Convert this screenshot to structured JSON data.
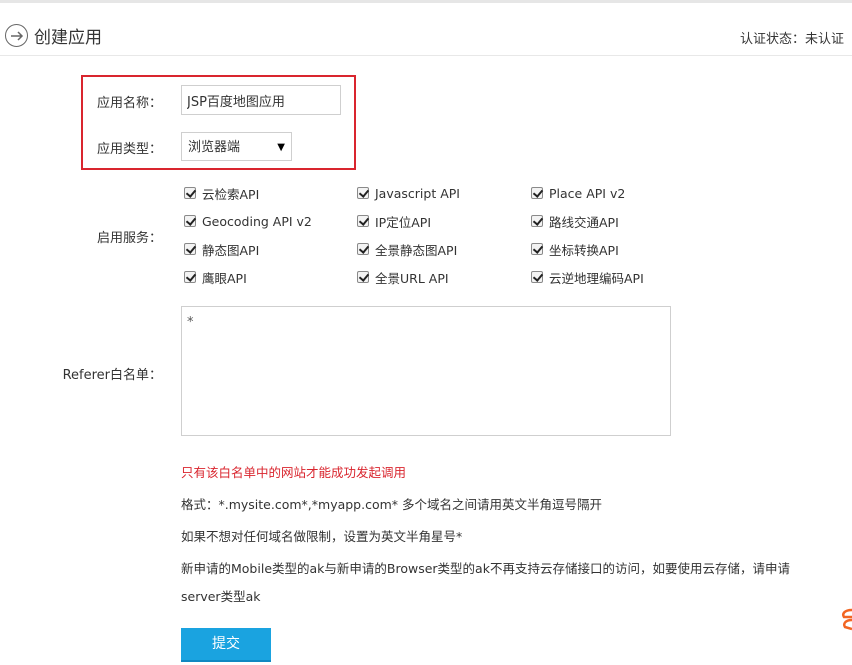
{
  "header": {
    "title": "创建应用",
    "auth_status": "认证状态：未认证"
  },
  "form": {
    "app_name_label": "应用名称：",
    "app_name_value": "JSP百度地图应用",
    "app_type_label": "应用类型：",
    "app_type_value": "浏览器端",
    "services_label": "启用服务：",
    "services": [
      [
        "云检索API",
        "Javascript API",
        "Place API v2"
      ],
      [
        "Geocoding API v2",
        "IP定位API",
        "路线交通API"
      ],
      [
        "静态图API",
        "全景静态图API",
        "坐标转换API"
      ],
      [
        "鹰眼API",
        "全景URL API",
        "云逆地理编码API"
      ]
    ],
    "referer_label": "Referer白名单：",
    "referer_value": "*"
  },
  "notes": {
    "warning": "只有该白名单中的网站才能成功发起调用",
    "format": "格式：*.mysite.com*,*myapp.com* 多个域名之间请用英文半角逗号隔开",
    "no_limit": "如果不想对任何域名做限制，设置为英文半角星号*",
    "mobile_line1": "新申请的Mobile类型的ak与新申请的Browser类型的ak不再支持云存储接口的访问，如要使用云存储，请申请",
    "mobile_line2": "server类型ak"
  },
  "submit_label": "提交",
  "colors": {
    "accent": "#1aa3e0",
    "warning": "#d9252e"
  }
}
